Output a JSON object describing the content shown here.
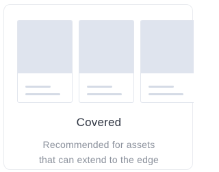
{
  "option": {
    "title": "Covered",
    "description_lines": [
      "Recommended for assets",
      "that can extend to the edge"
    ]
  },
  "colors": {
    "card_border": "#e9ebef",
    "tile_image": "#dfe4ee",
    "tile_line": "#d5dbe6",
    "title_text": "#2d3340",
    "description_text": "#8b919c"
  }
}
